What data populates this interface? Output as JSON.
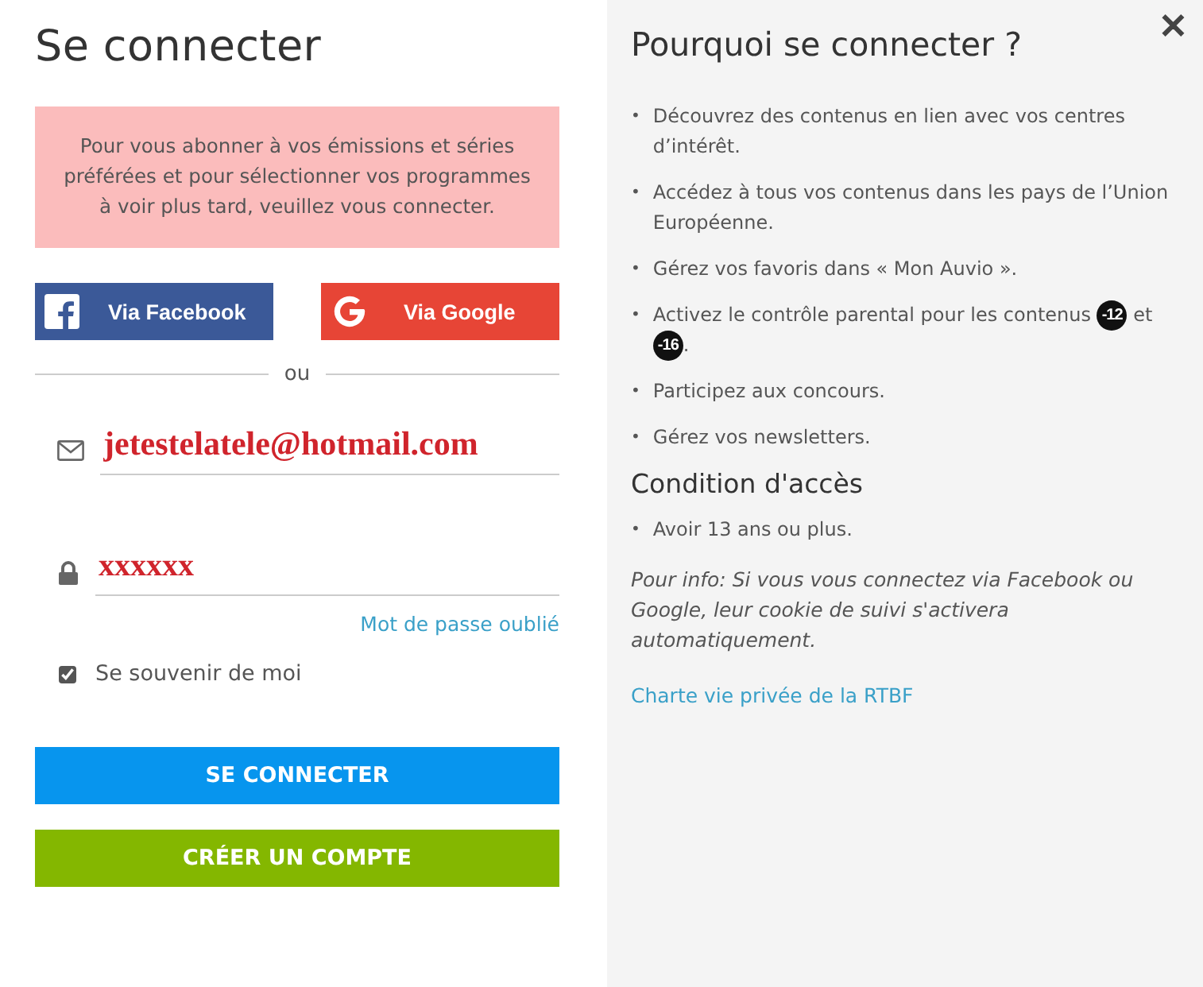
{
  "login": {
    "title": "Se connecter",
    "notice": "Pour vous abonner à vos émissions et séries préférées et pour sélectionner vos programmes à voir plus tard, veuillez vous connecter.",
    "social_buttons": [
      {
        "kind": "facebook",
        "label": "Via Facebook"
      },
      {
        "kind": "google",
        "label": "Via Google"
      }
    ],
    "separator": "ou",
    "fields": [
      {
        "kind": "email",
        "value": "jetestelatele@hotmail.com"
      },
      {
        "kind": "password",
        "value": "xxxxxx"
      }
    ],
    "forgot_link": "Mot de passe oublié",
    "remember": {
      "label": "Se souvenir de moi",
      "checked": true
    },
    "buttons": [
      {
        "kind": "primary",
        "label": "SE CONNECTER"
      },
      {
        "kind": "secondary",
        "label": "CRÉER UN COMPTE"
      }
    ]
  },
  "info": {
    "title": "Pourquoi se connecter ?",
    "close": "✕",
    "benefits": [
      {
        "marker": "•",
        "parts": [
          {
            "kind": "text",
            "text": "Découvrez des contenus en lien avec vos centres d’intérêt."
          }
        ]
      },
      {
        "marker": "•",
        "parts": [
          {
            "kind": "text",
            "text": "Accédez à tous vos contenus dans les pays de l’Union Européenne."
          }
        ]
      },
      {
        "marker": "•",
        "parts": [
          {
            "kind": "text",
            "text": "Gérez vos favoris dans « Mon Auvio »."
          }
        ]
      },
      {
        "marker": "•",
        "parts": [
          {
            "kind": "text",
            "text": "Activez le contrôle parental pour les contenus"
          },
          {
            "kind": "badge",
            "text": "-12"
          },
          {
            "kind": "text",
            "text": "et"
          },
          {
            "kind": "badge",
            "text": "-16"
          },
          {
            "kind": "text",
            "text": "."
          }
        ]
      },
      {
        "marker": "•",
        "parts": [
          {
            "kind": "text",
            "text": "Participez aux concours."
          }
        ]
      },
      {
        "marker": "•",
        "parts": [
          {
            "kind": "text",
            "text": "Gérez vos newsletters."
          }
        ]
      }
    ],
    "conditions_title": "Condition d'accès",
    "conditions": [
      {
        "marker": "•",
        "text": "Avoir 13 ans ou plus."
      }
    ],
    "note": "*Pour info*: Si vous vous connectez via Facebook ou Google, leur cookie de suivi s'activera automatiquement.",
    "privacy_link": "Charte vie privée de la RTBF"
  }
}
